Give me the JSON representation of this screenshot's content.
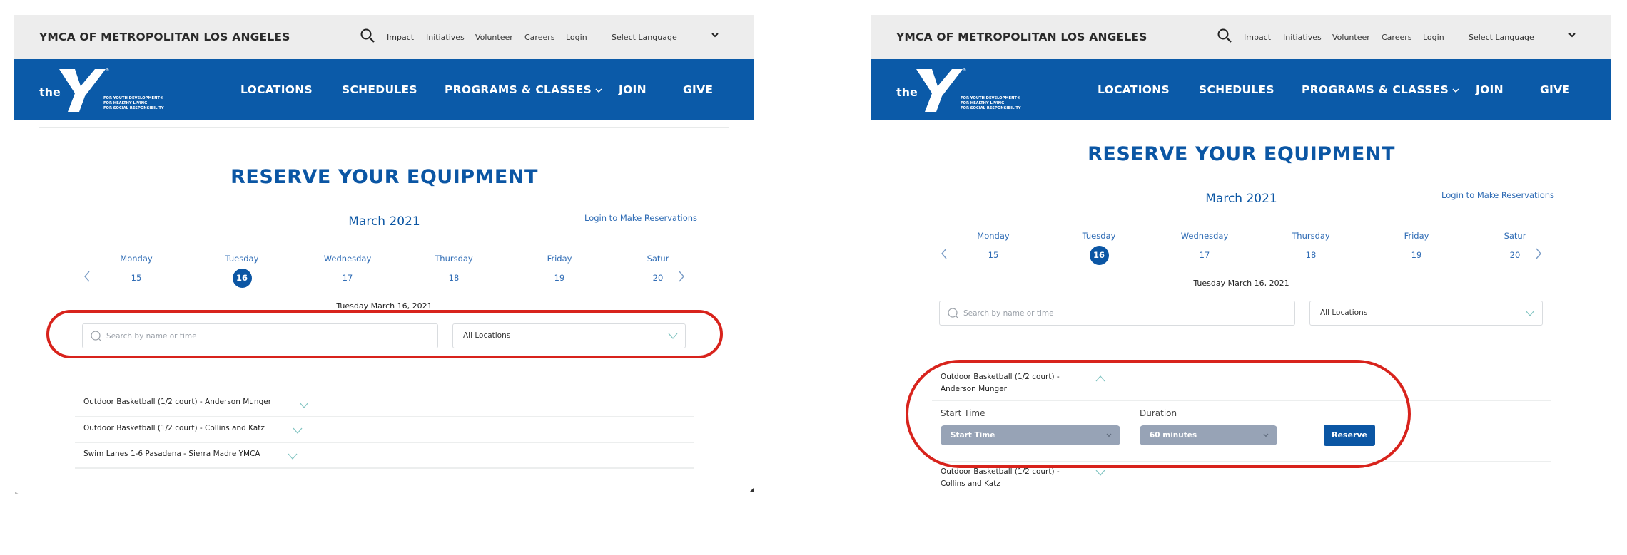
{
  "colors": {
    "brand_blue": "#0b5aa8",
    "title_blue": "#0b56a4",
    "link_blue": "#2f6cb5",
    "utility_gray": "#ededed",
    "select_gray": "#97a3b6",
    "annotation_red": "#d8231c",
    "chevron_teal": "#7fc3c0"
  },
  "panels": [
    {
      "utility_bar": {
        "org_title": "YMCA OF METROPOLITAN LOS ANGELES",
        "search_icon": "search-icon",
        "links": [
          "Impact",
          "Initiatives",
          "Volunteer",
          "Careers",
          "Login"
        ],
        "language_select": "Select Language"
      },
      "main_nav": {
        "logo": {
          "word": "the",
          "letter": "Y",
          "tagline": [
            "FOR YOUTH DEVELOPMENT®",
            "FOR HEALTHY LIVING",
            "FOR SOCIAL RESPONSIBILITY"
          ]
        },
        "items": [
          "LOCATIONS",
          "SCHEDULES",
          "PROGRAMS & CLASSES",
          "JOIN",
          "GIVE"
        ]
      },
      "page_title": "RESERVE YOUR EQUIPMENT",
      "calendar": {
        "month": "March 2021",
        "login_link": "Login to Make Reservations",
        "days": [
          {
            "name": "Monday",
            "num": "15"
          },
          {
            "name": "Tuesday",
            "num": "16",
            "selected": true
          },
          {
            "name": "Wednesday",
            "num": "17"
          },
          {
            "name": "Thursday",
            "num": "18"
          },
          {
            "name": "Friday",
            "num": "19"
          },
          {
            "name": "Satur",
            "num": "20"
          }
        ],
        "selected_date": "Tuesday March 16, 2021"
      },
      "filters": {
        "search_placeholder": "Search by name or time",
        "search_value": "",
        "location_value": "All Locations"
      },
      "list": [
        "Outdoor Basketball (1/2 court) - Anderson Munger",
        "Outdoor Basketball (1/2 court) - Collins and Katz",
        "Swim Lanes 1-6 Pasadena - Sierra Madre YMCA"
      ]
    },
    {
      "utility_bar": {
        "org_title": "YMCA OF METROPOLITAN LOS ANGELES",
        "search_icon": "search-icon",
        "links": [
          "Impact",
          "Initiatives",
          "Volunteer",
          "Careers",
          "Login"
        ],
        "language_select": "Select Language"
      },
      "main_nav": {
        "logo": {
          "word": "the",
          "letter": "Y",
          "tagline": [
            "FOR YOUTH DEVELOPMENT®",
            "FOR HEALTHY LIVING",
            "FOR SOCIAL RESPONSIBILITY"
          ]
        },
        "items": [
          "LOCATIONS",
          "SCHEDULES",
          "PROGRAMS & CLASSES",
          "JOIN",
          "GIVE"
        ]
      },
      "page_title": "RESERVE YOUR EQUIPMENT",
      "calendar": {
        "month": "March 2021",
        "login_link": "Login to Make Reservations",
        "days": [
          {
            "name": "Monday",
            "num": "15"
          },
          {
            "name": "Tuesday",
            "num": "16",
            "selected": true
          },
          {
            "name": "Wednesday",
            "num": "17"
          },
          {
            "name": "Thursday",
            "num": "18"
          },
          {
            "name": "Friday",
            "num": "19"
          },
          {
            "name": "Satur",
            "num": "20"
          }
        ],
        "selected_date": "Tuesday March 16, 2021"
      },
      "filters": {
        "search_placeholder": "Search by name or time",
        "search_value": "",
        "location_value": "All Locations"
      },
      "expanded_item": {
        "label_line1": "Outdoor Basketball (1/2 court) -",
        "label_line2": "Anderson Munger",
        "start_time_label": "Start Time",
        "start_time_value": "Start Time",
        "duration_label": "Duration",
        "duration_value": "60 minutes",
        "reserve_label": "Reserve"
      },
      "next_item": {
        "label_line1": "Outdoor Basketball (1/2 court) -",
        "label_line2": "Collins and Katz"
      }
    }
  ]
}
